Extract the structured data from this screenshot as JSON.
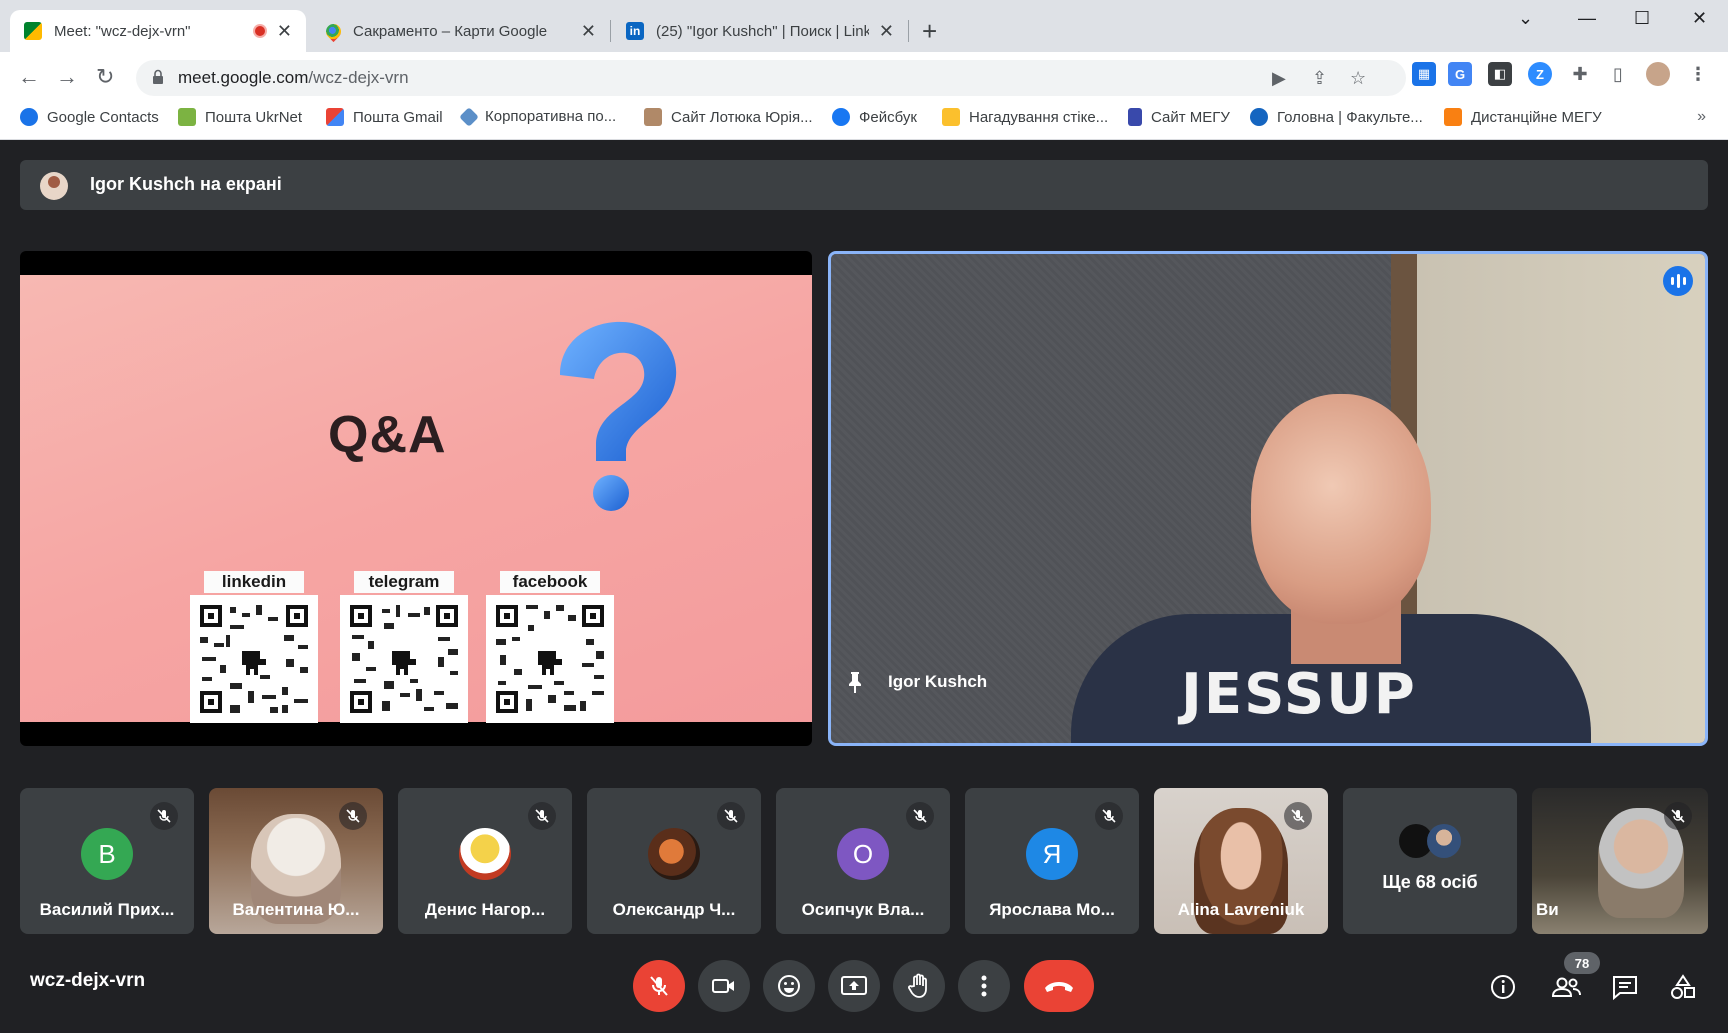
{
  "browser": {
    "tabs": [
      {
        "title": "Meet: \"wcz-dejx-vrn\"",
        "favicon": "google-meet-icon"
      },
      {
        "title": "Сакраменто – Карти Google",
        "favicon": "google-maps-icon"
      },
      {
        "title": "(25) \"Igor Kushch\" | Поиск | Linke",
        "favicon": "linkedin-icon"
      }
    ],
    "url_host": "meet.google.com",
    "url_path": "/wcz-dejx-vrn",
    "bookmarks": [
      "Google Contacts",
      "Пошта UkrNet",
      "Пошта Gmail",
      "Корпоративна по...",
      "Сайт Лотюка Юрія...",
      "Фейсбук",
      "Нагадування стіке...",
      "Сайт МЕГУ",
      "Головна | Факульте...",
      "Дистанційне МЕГУ"
    ],
    "bookmarks_more": "»"
  },
  "meet": {
    "presenting_banner": "Igor Kushch на екрані",
    "slide": {
      "title": "Q&A",
      "qr_labels": [
        "linkedin",
        "telegram",
        "facebook"
      ]
    },
    "speaker": {
      "name": "Igor Kushch",
      "shirt_text": "JESSUP"
    },
    "participants": [
      {
        "name": "Василий Прих...",
        "initial": "В",
        "color": "#34a853",
        "type": "avatar"
      },
      {
        "name": "Валентина Ю...",
        "type": "video"
      },
      {
        "name": "Денис Нагор...",
        "type": "photo"
      },
      {
        "name": "Олександр Ч...",
        "type": "photo"
      },
      {
        "name": "Осипчук Вла...",
        "initial": "О",
        "color": "#7e57c2",
        "type": "avatar"
      },
      {
        "name": "Ярослава Мо...",
        "initial": "Я",
        "color": "#1e88e5",
        "type": "avatar"
      },
      {
        "name": "Alina Lavreniuk",
        "type": "video"
      },
      {
        "name": "Ще 68 осіб",
        "type": "more"
      },
      {
        "name": "Ви",
        "type": "video"
      }
    ],
    "meeting_code": "wcz-dejx-vrn",
    "participant_count": "78",
    "colors": {
      "accent": "#8ab4f8",
      "danger": "#ea4335",
      "panel": "#3c4043",
      "background": "#202124"
    }
  }
}
